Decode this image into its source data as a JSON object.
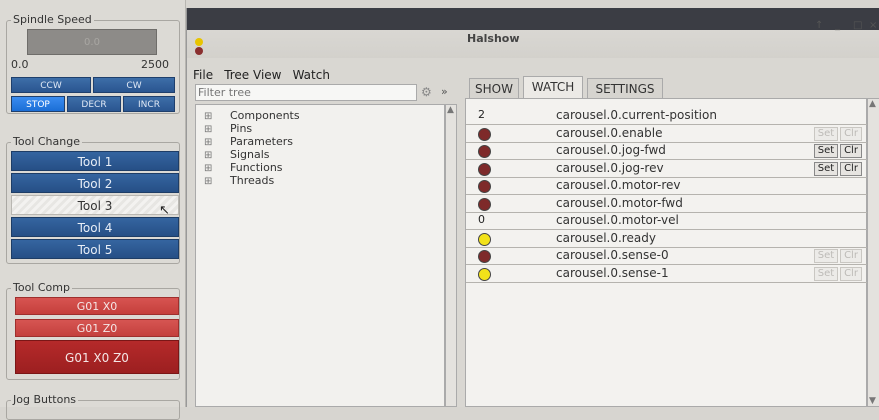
{
  "spindle": {
    "title": "Spindle Speed",
    "display_value": "0.0",
    "range_min": "0.0",
    "range_max": "2500",
    "ccw_label": "CCW",
    "cw_label": "CW",
    "stop_label": "STOP",
    "decr_label": "DECR",
    "incr_label": "INCR"
  },
  "tool_change": {
    "title": "Tool Change",
    "tools": [
      "Tool 1",
      "Tool 2",
      "Tool 3",
      "Tool 4",
      "Tool 5"
    ],
    "selected": "Tool 3"
  },
  "tool_comp": {
    "title": "Tool Comp",
    "buttons": [
      "G01 X0",
      "G01 Z0",
      "G01 X0 Z0"
    ]
  },
  "jog": {
    "title": "Jog Buttons"
  },
  "halshow": {
    "title": "Halshow",
    "menu": [
      "File",
      "Tree View",
      "Watch"
    ],
    "filter_placeholder": "Filter tree",
    "tree": [
      "Components",
      "Pins",
      "Parameters",
      "Signals",
      "Functions",
      "Threads"
    ],
    "tabs": [
      "SHOW",
      "WATCH",
      "SETTINGS"
    ],
    "active_tab": "WATCH",
    "set_label": "Set",
    "clr_label": "Clr",
    "colors": {
      "led_off": "#7e2a2a",
      "led_on": "#f2e21a"
    },
    "watch": [
      {
        "kind": "value",
        "value": "2",
        "name": "carousel.0.current-position",
        "buttons": "none"
      },
      {
        "kind": "led",
        "state": "off",
        "name": "carousel.0.enable",
        "buttons": "disabled"
      },
      {
        "kind": "led",
        "state": "off",
        "name": "carousel.0.jog-fwd",
        "buttons": "enabled"
      },
      {
        "kind": "led",
        "state": "off",
        "name": "carousel.0.jog-rev",
        "buttons": "enabled"
      },
      {
        "kind": "led",
        "state": "off",
        "name": "carousel.0.motor-rev",
        "buttons": "none"
      },
      {
        "kind": "led",
        "state": "off",
        "name": "carousel.0.motor-fwd",
        "buttons": "none"
      },
      {
        "kind": "value",
        "value": "0",
        "name": "carousel.0.motor-vel",
        "buttons": "none"
      },
      {
        "kind": "led",
        "state": "on",
        "name": "carousel.0.ready",
        "buttons": "none"
      },
      {
        "kind": "led",
        "state": "off",
        "name": "carousel.0.sense-0",
        "buttons": "disabled"
      },
      {
        "kind": "led",
        "state": "on",
        "name": "carousel.0.sense-1",
        "buttons": "disabled"
      }
    ]
  }
}
